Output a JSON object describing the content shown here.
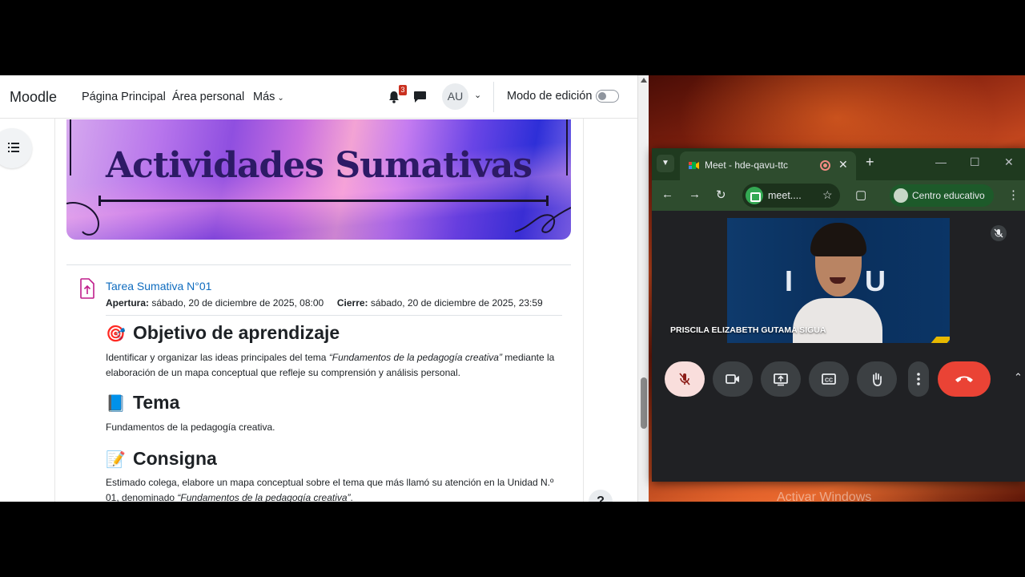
{
  "moodle": {
    "brand": "Moodle",
    "nav": {
      "home": "Página Principal",
      "personal": "Área personal",
      "more": "Más"
    },
    "notifications_count": "3",
    "avatar_initials": "AU",
    "edit_mode_label": "Modo de edición",
    "edit_mode_on": false
  },
  "banner": {
    "title": "Actividades Sumativas"
  },
  "activity": {
    "link": "Tarea Sumativa N°01",
    "opening_label": "Apertura:",
    "opening_value": "sábado, 20 de diciembre de 2025, 08:00",
    "closing_label": "Cierre:",
    "closing_value": "sábado, 20 de diciembre de 2025, 23:59"
  },
  "sections": {
    "objective": {
      "emoji": "🎯",
      "heading": "Objetivo de aprendizaje",
      "text_before": "Identificar y organizar las ideas principales del tema ",
      "text_italic": "“Fundamentos de la pedagogía creativa”",
      "text_after": " mediante la elaboración de un mapa conceptual que refleje su comprensión y análisis personal."
    },
    "topic": {
      "emoji": "📘",
      "heading": "Tema",
      "text": "Fundamentos de la pedagogía creativa."
    },
    "instructions": {
      "emoji": "📝",
      "heading": "Consigna",
      "text_before": "Estimado colega, elabore un mapa conceptual sobre el tema que más llamó su atención en la Unidad N.º 01, denominado ",
      "text_italic": "“Fundamentos de la pedagogía creativa”",
      "text_after": "."
    }
  },
  "help_label": "?",
  "browser": {
    "tab_title": "Meet - hde-qavu-ttc",
    "address": "meet....",
    "profile_label": "Centro educativo"
  },
  "meet": {
    "participant_name": "PRISCILA ELIZABETH GUTAMA SIGUA"
  },
  "desktop": {
    "watermark": "Activar Windows"
  },
  "colors": {
    "moodle_link": "#0f6cbf",
    "hangup": "#ea4335",
    "mic_off_bg": "#f9dedc"
  }
}
